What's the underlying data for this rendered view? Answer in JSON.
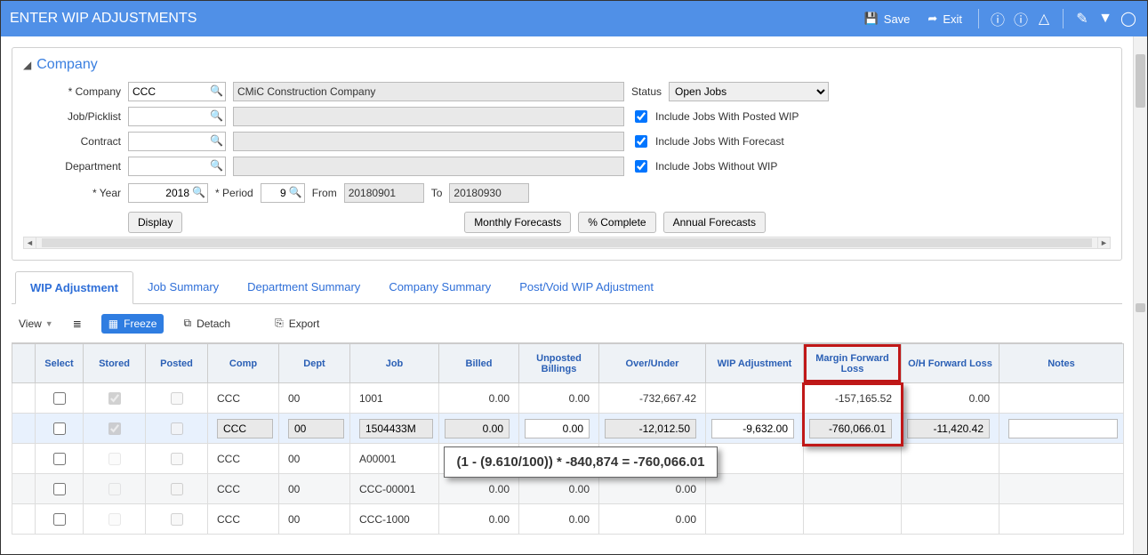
{
  "header": {
    "title": "ENTER WIP ADJUSTMENTS",
    "save": "Save",
    "exit": "Exit"
  },
  "company_section": {
    "heading": "Company",
    "labels": {
      "company": "Company",
      "job": "Job/Picklist",
      "contract": "Contract",
      "department": "Department",
      "year": "Year",
      "period": "Period",
      "from": "From",
      "to": "To",
      "status": "Status"
    },
    "values": {
      "company_code": "CCC",
      "company_name": "CMiC Construction Company",
      "job": "",
      "job_name": "",
      "contract": "",
      "contract_name": "",
      "department": "",
      "department_name": "",
      "year": "2018",
      "period": "9",
      "from": "20180901",
      "to": "20180930",
      "status": "Open Jobs"
    },
    "checks": {
      "posted_wip": "Include Jobs With Posted WIP",
      "forecast": "Include Jobs With Forecast",
      "without_wip": "Include Jobs Without WIP"
    },
    "buttons": {
      "display": "Display",
      "monthly": "Monthly Forecasts",
      "pct": "% Complete",
      "annual": "Annual Forecasts"
    }
  },
  "tabs": {
    "t0": "WIP Adjustment",
    "t1": "Job Summary",
    "t2": "Department Summary",
    "t3": "Company Summary",
    "t4": "Post/Void WIP Adjustment"
  },
  "toolbar": {
    "view": "View",
    "freeze": "Freeze",
    "detach": "Detach",
    "export": "Export"
  },
  "grid": {
    "cols": {
      "select": "Select",
      "stored": "Stored",
      "posted": "Posted",
      "comp": "Comp",
      "dept": "Dept",
      "job": "Job",
      "billed": "Billed",
      "unposted": "Unposted Billings",
      "overunder": "Over/Under",
      "wipadj": "WIP Adjustment",
      "mfl": "Margin Forward Loss",
      "ofl": "O/H Forward Loss",
      "notes": "Notes"
    },
    "rows": [
      {
        "stored": true,
        "comp": "CCC",
        "dept": "00",
        "job": "1001",
        "billed": "0.00",
        "unposted": "0.00",
        "overunder": "-732,667.42",
        "wipadj": "",
        "mfl": "-157,165.52",
        "ofl": "0.00",
        "notes": ""
      },
      {
        "stored": true,
        "comp": "CCC",
        "dept": "00",
        "job": "1504433M",
        "billed": "0.00",
        "unposted": "0.00",
        "overunder": "-12,012.50",
        "wipadj": "-9,632.00",
        "mfl": "-760,066.01",
        "ofl": "-11,420.42",
        "notes": "",
        "selected": true
      },
      {
        "stored": false,
        "comp": "CCC",
        "dept": "00",
        "job": "A00001",
        "billed": "",
        "unposted": "",
        "overunder": "",
        "wipadj": "",
        "mfl": "",
        "ofl": "",
        "notes": ""
      },
      {
        "stored": false,
        "comp": "CCC",
        "dept": "00",
        "job": "CCC-00001",
        "billed": "0.00",
        "unposted": "0.00",
        "overunder": "0.00",
        "wipadj": "",
        "mfl": "",
        "ofl": "",
        "notes": ""
      },
      {
        "stored": false,
        "comp": "CCC",
        "dept": "00",
        "job": "CCC-1000",
        "billed": "0.00",
        "unposted": "0.00",
        "overunder": "0.00",
        "wipadj": "",
        "mfl": "",
        "ofl": "",
        "notes": ""
      }
    ]
  },
  "formula": "(1 - (9.610/100)) * -840,874 = -760,066.01"
}
